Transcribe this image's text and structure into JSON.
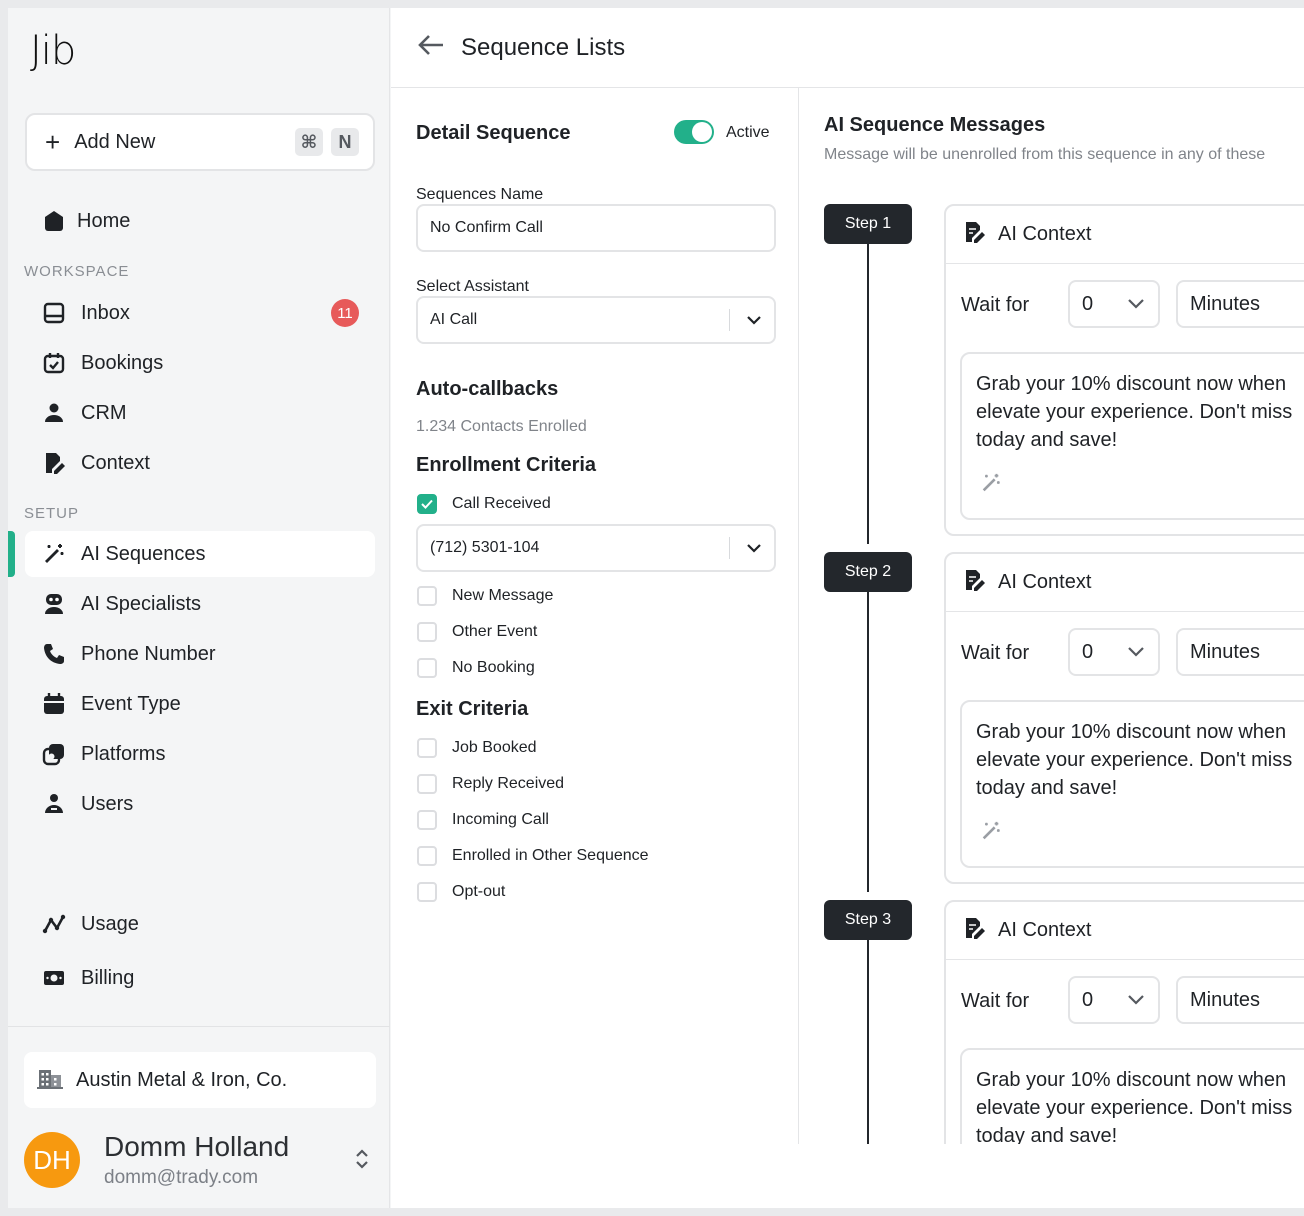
{
  "app": {
    "logo": "Jib"
  },
  "sidebar": {
    "add_new": {
      "label": "Add New",
      "shortcut_mod": "⌘",
      "shortcut_key": "N"
    },
    "home": "Home",
    "workspace_label": "WORKSPACE",
    "workspace_items": [
      {
        "label": "Inbox",
        "badge": "11",
        "icon": "inbox-icon"
      },
      {
        "label": "Bookings",
        "icon": "calendar-check-icon"
      },
      {
        "label": "CRM",
        "icon": "user-icon"
      },
      {
        "label": "Context",
        "icon": "edit-document-icon"
      }
    ],
    "setup_label": "SETUP",
    "setup_items": [
      {
        "label": "AI Sequences",
        "icon": "magic-wand-icon",
        "active": true
      },
      {
        "label": "AI Specialists",
        "icon": "robot-icon"
      },
      {
        "label": "Phone Number",
        "icon": "phone-icon"
      },
      {
        "label": "Event Type",
        "icon": "calendar-icon"
      },
      {
        "label": "Platforms",
        "icon": "platforms-icon"
      },
      {
        "label": "Users",
        "icon": "users-icon"
      }
    ],
    "bottom_items": [
      {
        "label": "Usage",
        "icon": "chart-line-icon"
      },
      {
        "label": "Billing",
        "icon": "money-icon"
      }
    ],
    "company": "Austin Metal & Iron, Co.",
    "user": {
      "initials": "DH",
      "name": "Domm Holland",
      "email": "domm@trady.com"
    }
  },
  "header": {
    "title": "Sequence Lists"
  },
  "detail": {
    "title": "Detail Sequence",
    "toggle_label": "Active",
    "name_label": "Sequences Name",
    "name_value": "No Confirm Call",
    "assistant_label": "Select Assistant",
    "assistant_value": "AI Call",
    "autocallbacks_title": "Auto-callbacks",
    "autocallbacks_sub": "1.234 Contacts Enrolled",
    "enrollment_title": "Enrollment Criteria",
    "call_received": "Call Received",
    "phone_value": "(712) 5301-104",
    "enrollment_options": [
      "New Message",
      "Other Event",
      "No Booking"
    ],
    "exit_title": "Exit Criteria",
    "exit_options": [
      "Job Booked",
      "Reply Received",
      "Incoming Call",
      "Enrolled in Other Sequence",
      "Opt-out"
    ]
  },
  "messages": {
    "title": "AI Sequence Messages",
    "subtitle": "Message will be unenrolled from this sequence in any of these",
    "steps": [
      {
        "label": "Step 1",
        "card_title": "AI Context",
        "wait_label": "Wait for",
        "wait_value": "0",
        "unit": "Minutes",
        "message": "Grab your 10% discount now when elevate your experience. Don't miss today and save!"
      },
      {
        "label": "Step 2",
        "card_title": "AI Context",
        "wait_label": "Wait for",
        "wait_value": "0",
        "unit": "Minutes",
        "message": "Grab your 10% discount now when elevate your experience. Don't miss today and save!"
      },
      {
        "label": "Step 3",
        "card_title": "AI Context",
        "wait_label": "Wait for",
        "wait_value": "0",
        "unit": "Minutes",
        "message": "Grab your 10% discount now when elevate your experience. Don't miss today and save!"
      }
    ]
  },
  "colors": {
    "accent": "#22b08a",
    "badge": "#e75a5a",
    "avatar": "#f7990f",
    "step_pill": "#23272c"
  }
}
